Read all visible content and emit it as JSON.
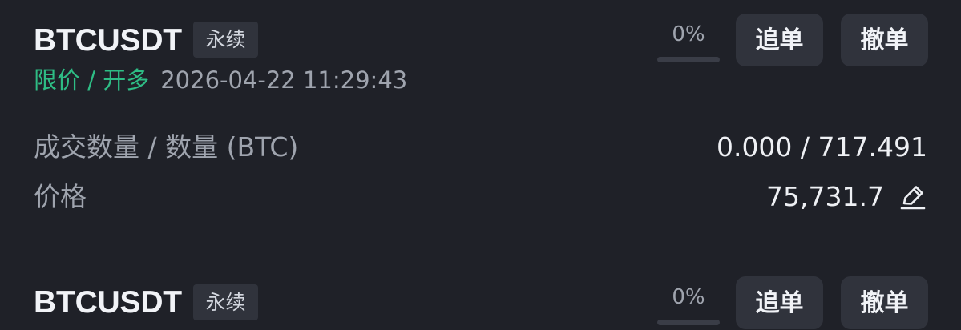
{
  "orders": [
    {
      "symbol": "BTCUSDT",
      "contract_type": "永续",
      "fill_percent_label": "0%",
      "fill_percent": 0,
      "chase_label": "追单",
      "cancel_label": "撤单",
      "side": "限价 / 开多",
      "time": "2026-04-22 11:29:43",
      "qty_label": "成交数量 / 数量 (BTC)",
      "qty_value": "0.000 / 717.491",
      "price_label": "价格",
      "price_value": "75,731.7"
    },
    {
      "symbol": "BTCUSDT",
      "contract_type": "永续",
      "fill_percent_label": "0%",
      "fill_percent": 0,
      "chase_label": "追单",
      "cancel_label": "撤单"
    }
  ],
  "colors": {
    "background": "#1f2128",
    "long_green": "#2ebd85",
    "muted_text": "#9fa4ae",
    "button_bg": "#30333c"
  },
  "icons": {
    "edit": "edit-icon"
  }
}
